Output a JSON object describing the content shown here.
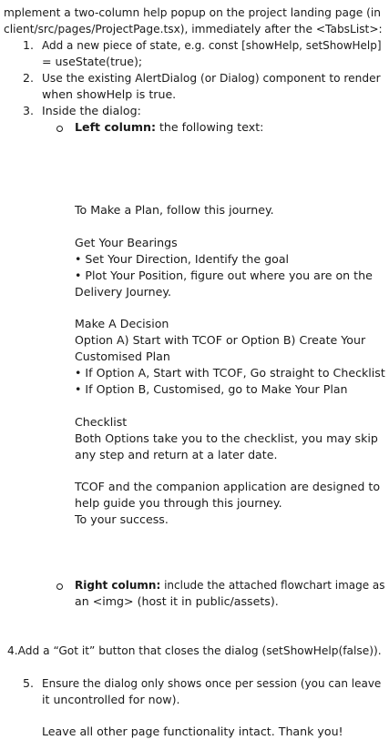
{
  "intro": {
    "line1": "mplement a two-column help popup on the project landing page (in",
    "line2": "client/src/pages/ProjectPage.tsx), immediately after the <TabsList>:"
  },
  "steps": {
    "s1": {
      "num": "1.",
      "line1": "Add a new piece of state, e.g. const [showHelp, setShowHelp]",
      "line2": "= useState(true);"
    },
    "s2": {
      "num": "2.",
      "line1": "Use the existing AlertDialog (or Dialog) component to render",
      "line2": "when showHelp is true."
    },
    "s3": {
      "num": "3.",
      "line1": "Inside the dialog:"
    }
  },
  "left_column": {
    "label": "Left column:",
    "rest": " the following text:"
  },
  "help_text": {
    "p0": "To Make a Plan, follow this journey.",
    "h1": "Get Your Bearings",
    "b1": "• Set Your Direction, Identify the goal",
    "b2a": "• Plot Your Position, figure out where you are on the",
    "b2b": "Delivery Journey.",
    "h2": "Make A Decision",
    "o1a": "Option A) Start with TCOF or Option B) Create Your",
    "o1b": "Customised Plan",
    "b3": "• If Option A, Start with TCOF, Go straight to Checklist",
    "b4": "• If Option B, Customised, go to Make Your Plan",
    "h3": "Checklist",
    "c1a": "Both Options take you to the checklist, you may skip",
    "c1b": "any step and return at a later date.",
    "t1a": "TCOF and the companion application are designed to",
    "t1b": "help guide you through this journey.",
    "t1c": "To your success."
  },
  "right_column": {
    "label": "Right column:",
    "rest1": " include the attached flowchart image as",
    "line2": "an <img> (host it in public/assets)."
  },
  "step4": "4.Add a “Got it” button that closes the dialog (setShowHelp(false)).",
  "step5": {
    "num": "5.",
    "line1": "Ensure the dialog only shows once per session (you can leave",
    "line2": "it uncontrolled for now)."
  },
  "closing": "Leave all other page functionality intact. Thank you!"
}
